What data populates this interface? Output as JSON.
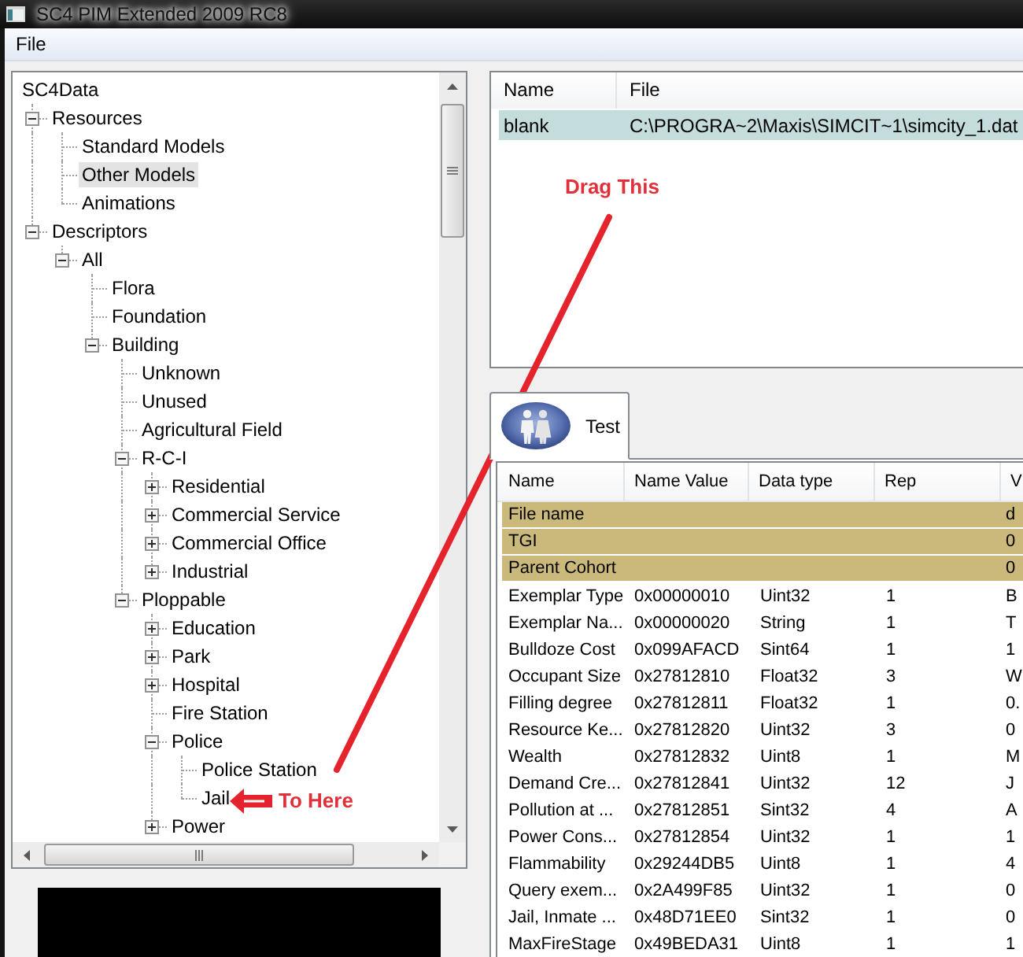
{
  "window": {
    "title": "SC4 PIM Extended 2009 RC8"
  },
  "menu": [
    {
      "label": "File"
    }
  ],
  "tree": {
    "root": {
      "label": "SC4Data",
      "selected": false,
      "children": [
        {
          "label": "Resources",
          "expanded": true,
          "selected": false,
          "children": [
            {
              "label": "Standard Models",
              "selected": false
            },
            {
              "label": "Other Models",
              "selected": true
            },
            {
              "label": "Animations",
              "selected": false
            }
          ]
        },
        {
          "label": "Descriptors",
          "expanded": true,
          "selected": false,
          "children": [
            {
              "label": "All",
              "expanded": true,
              "selected": false,
              "children": [
                {
                  "label": "Flora",
                  "selected": false
                },
                {
                  "label": "Foundation",
                  "selected": false
                },
                {
                  "label": "Building",
                  "expanded": true,
                  "selected": false,
                  "children": [
                    {
                      "label": "Unknown",
                      "selected": false
                    },
                    {
                      "label": "Unused",
                      "selected": false
                    },
                    {
                      "label": "Agricultural Field",
                      "selected": false
                    },
                    {
                      "label": "R-C-I",
                      "expanded": true,
                      "selected": false,
                      "children": [
                        {
                          "label": "Residential",
                          "expanded": false,
                          "selected": false
                        },
                        {
                          "label": "Commercial Service",
                          "expanded": false,
                          "selected": false
                        },
                        {
                          "label": "Commercial Office",
                          "expanded": false,
                          "selected": false
                        },
                        {
                          "label": "Industrial",
                          "expanded": false,
                          "selected": false
                        }
                      ]
                    },
                    {
                      "label": "Ploppable",
                      "expanded": true,
                      "selected": false,
                      "children": [
                        {
                          "label": "Education",
                          "expanded": false,
                          "selected": false
                        },
                        {
                          "label": "Park",
                          "expanded": false,
                          "selected": false
                        },
                        {
                          "label": "Hospital",
                          "expanded": false,
                          "selected": false
                        },
                        {
                          "label": "Fire Station",
                          "selected": false
                        },
                        {
                          "label": "Police",
                          "expanded": true,
                          "selected": false,
                          "children": [
                            {
                              "label": "Police Station",
                              "selected": false
                            },
                            {
                              "label": "Jail",
                              "selected": false
                            }
                          ]
                        },
                        {
                          "label": "Power",
                          "expanded": false,
                          "selected": false
                        }
                      ]
                    }
                  ]
                }
              ]
            }
          ]
        }
      ]
    }
  },
  "files": {
    "columns": [
      "Name",
      "File"
    ],
    "rows": [
      {
        "name": "blank",
        "file": "C:\\PROGRA~2\\Maxis\\SIMCIT~1\\simcity_1.dat",
        "selected": true
      }
    ]
  },
  "tabs": [
    {
      "label": "Test",
      "selected": true
    }
  ],
  "properties": {
    "columns": [
      "Name",
      "Name Value",
      "Data type",
      "Rep",
      "V"
    ],
    "rows": [
      {
        "highlighted": true,
        "name": "File name",
        "column_5": "d"
      },
      {
        "highlighted": true,
        "name": "TGI",
        "column_5": "0"
      },
      {
        "highlighted": true,
        "name": "Parent Cohort",
        "column_5": "0"
      },
      {
        "highlighted": false,
        "name": "Exemplar Type",
        "name_value": "0x00000010",
        "data_type": "Uint32",
        "rep": "1",
        "column_5": "B"
      },
      {
        "highlighted": false,
        "name": "Exemplar Na...",
        "name_value": "0x00000020",
        "data_type": "String",
        "rep": "1",
        "column_5": "T"
      },
      {
        "highlighted": false,
        "name": "Bulldoze Cost",
        "name_value": "0x099AFACD",
        "data_type": "Sint64",
        "rep": "1",
        "column_5": "1"
      },
      {
        "highlighted": false,
        "name": "Occupant Size",
        "name_value": "0x27812810",
        "data_type": "Float32",
        "rep": "3",
        "column_5": "W"
      },
      {
        "highlighted": false,
        "name": "Filling degree",
        "name_value": "0x27812811",
        "data_type": "Float32",
        "rep": "1",
        "column_5": "0."
      },
      {
        "highlighted": false,
        "name": "Resource Ke...",
        "name_value": "0x27812820",
        "data_type": "Uint32",
        "rep": "3",
        "column_5": "0"
      },
      {
        "highlighted": false,
        "name": "Wealth",
        "name_value": "0x27812832",
        "data_type": "Uint8",
        "rep": "1",
        "column_5": "M"
      },
      {
        "highlighted": false,
        "name": "Demand Cre...",
        "name_value": "0x27812841",
        "data_type": "Uint32",
        "rep": "12",
        "column_5": "J"
      },
      {
        "highlighted": false,
        "name": "Pollution at ...",
        "name_value": "0x27812851",
        "data_type": "Sint32",
        "rep": "4",
        "column_5": "A"
      },
      {
        "highlighted": false,
        "name": "Power Cons...",
        "name_value": "0x27812854",
        "data_type": "Uint32",
        "rep": "1",
        "column_5": "1"
      },
      {
        "highlighted": false,
        "name": "Flammability",
        "name_value": "0x29244DB5",
        "data_type": "Uint8",
        "rep": "1",
        "column_5": "4"
      },
      {
        "highlighted": false,
        "name": "Query exem...",
        "name_value": "0x2A499F85",
        "data_type": "Uint32",
        "rep": "1",
        "column_5": "0"
      },
      {
        "highlighted": false,
        "name": "Jail, Inmate ...",
        "name_value": "0x48D71EE0",
        "data_type": "Sint32",
        "rep": "1",
        "column_5": "0"
      },
      {
        "highlighted": false,
        "name": "MaxFireStage",
        "name_value": "0x49BEDA31",
        "data_type": "Uint8",
        "rep": "1",
        "column_5": "1"
      }
    ]
  },
  "annotations": [
    {
      "text": "Drag This"
    },
    {
      "text": "To Here"
    }
  ]
}
